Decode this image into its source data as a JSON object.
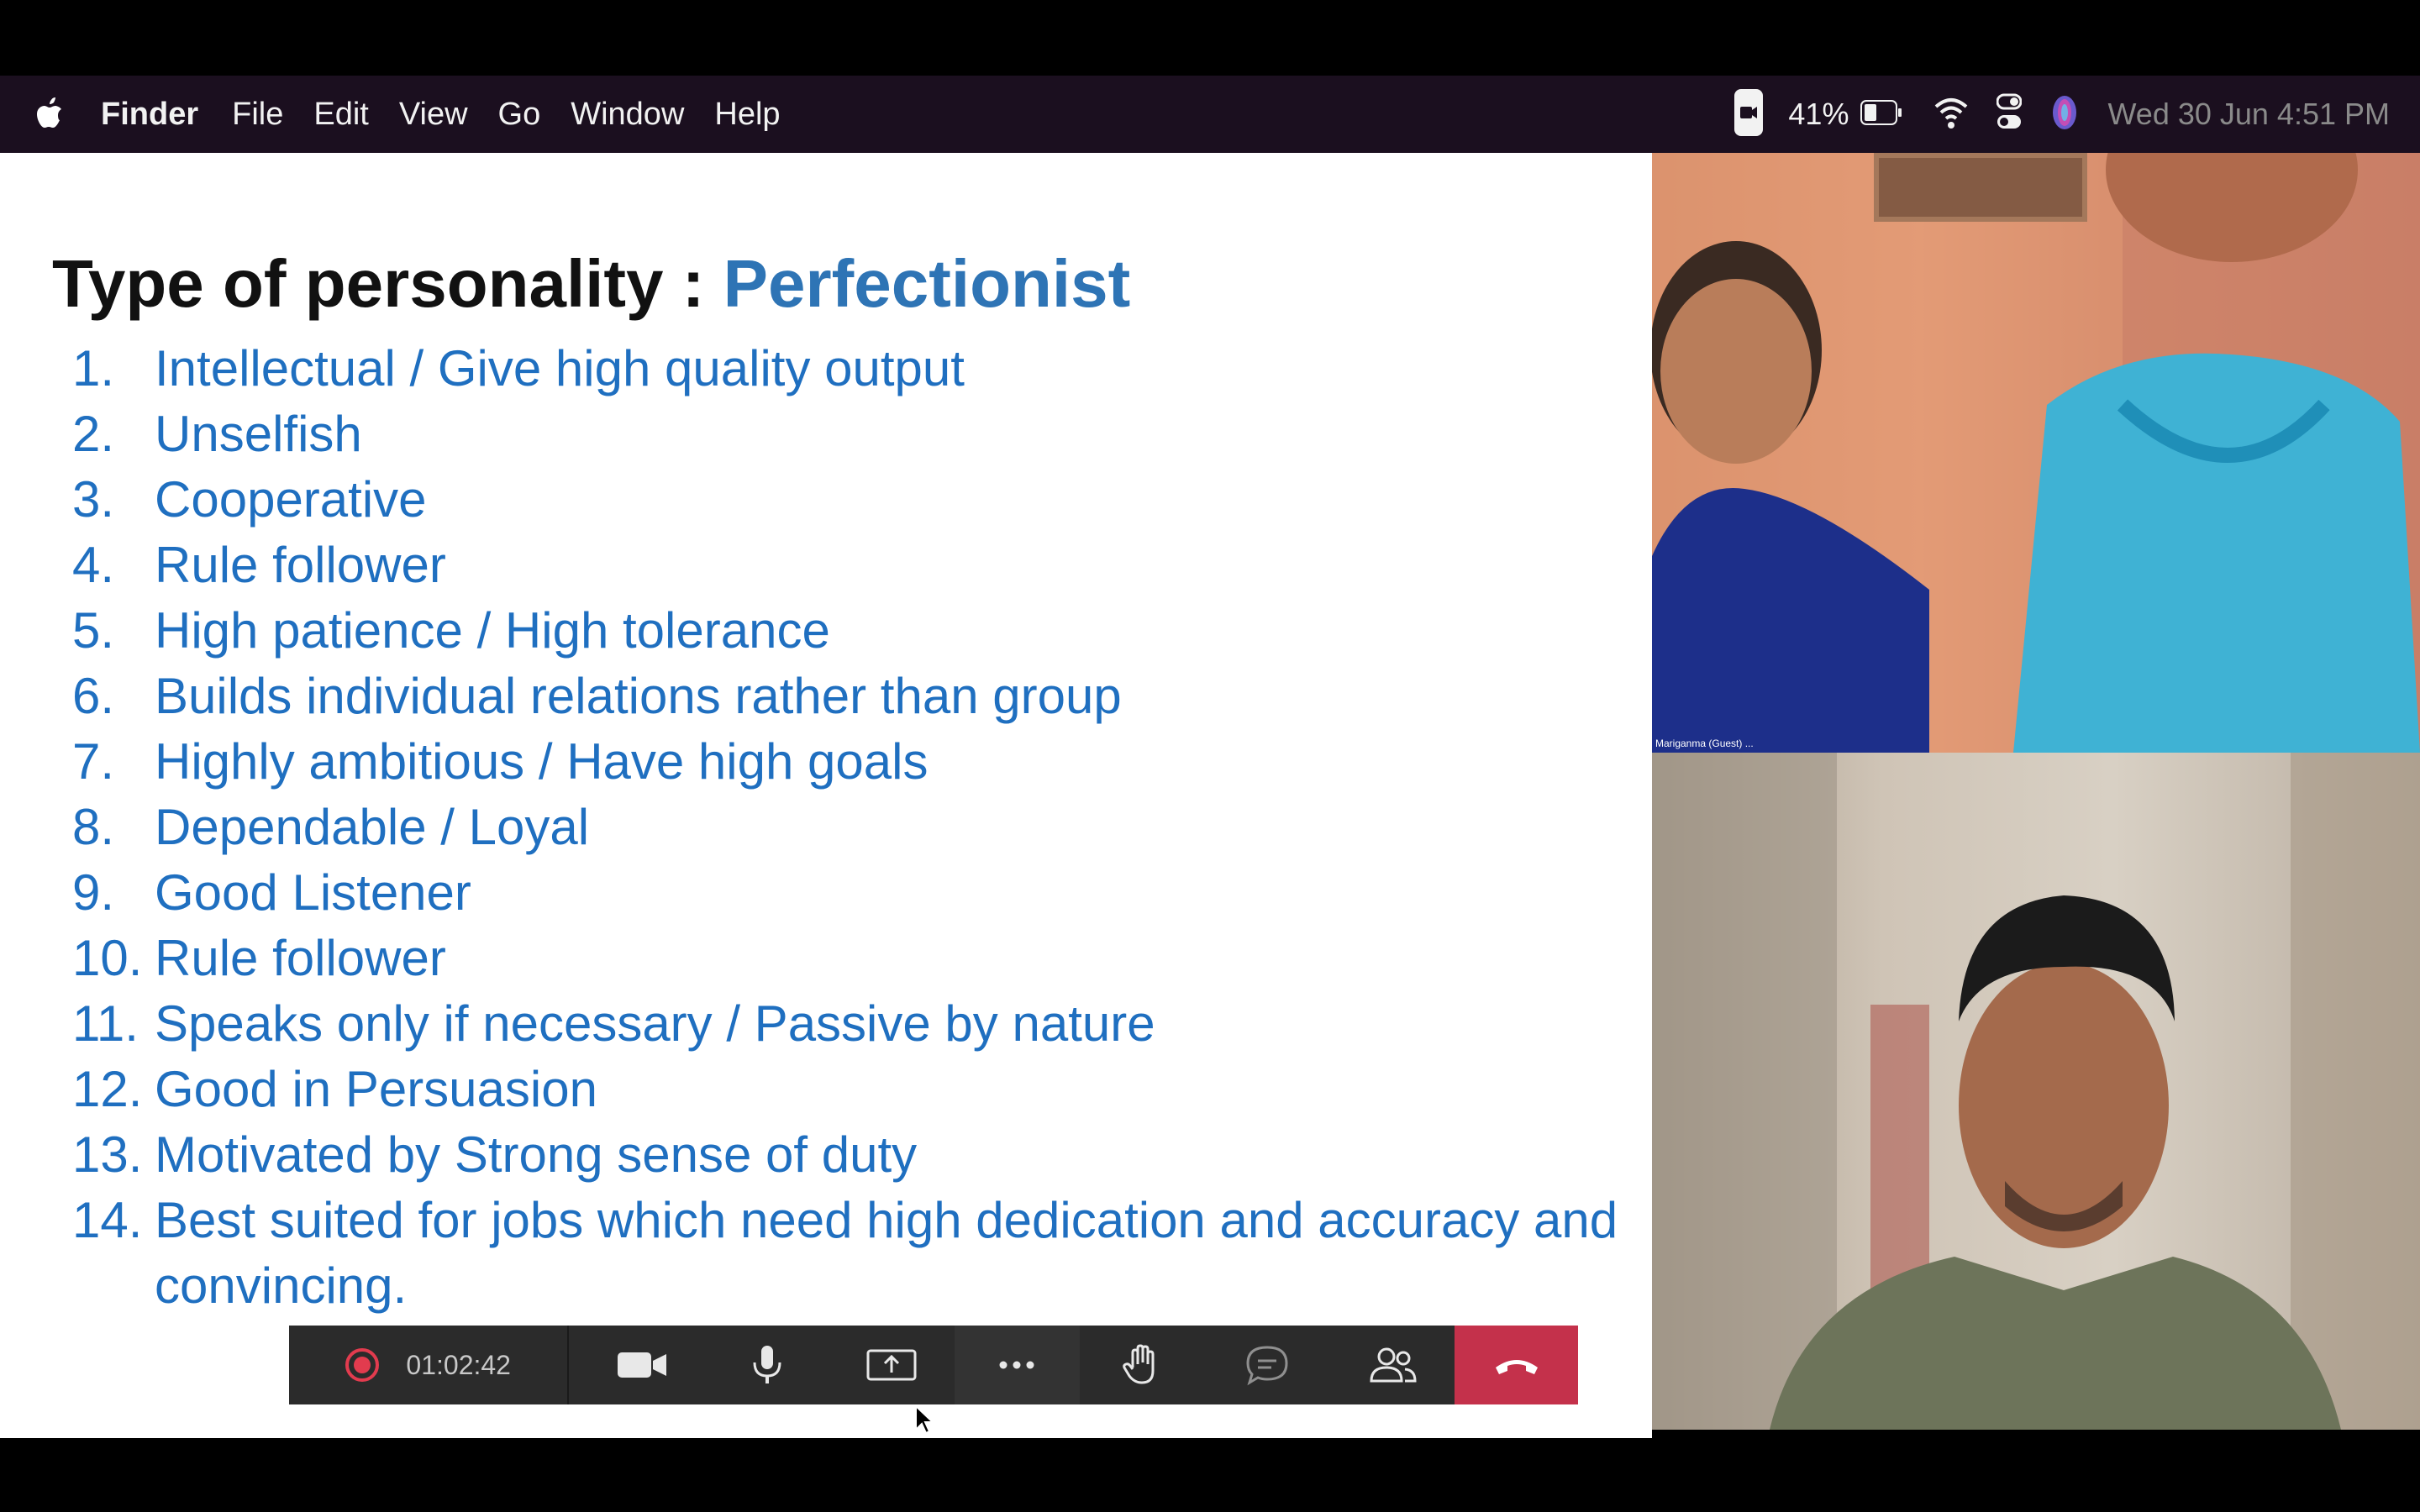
{
  "menubar": {
    "app_name": "Finder",
    "items": [
      "File",
      "Edit",
      "View",
      "Go",
      "Window",
      "Help"
    ],
    "battery_percent": "41%",
    "datetime": "Wed 30 Jun  4:51 PM"
  },
  "slide": {
    "title_prefix": "Type of personality : ",
    "title_accent": "Perfectionist",
    "items": [
      {
        "num": "1.",
        "text": "Intellectual  /  Give high quality output"
      },
      {
        "num": "2.",
        "text": "Unselfish"
      },
      {
        "num": "3.",
        "text": "Cooperative"
      },
      {
        "num": "4.",
        "text": "Rule follower"
      },
      {
        "num": "5.",
        "text": "High patience / High tolerance"
      },
      {
        "num": "6.",
        "text": "Builds individual relations rather than group"
      },
      {
        "num": "7.",
        "text": "Highly ambitious / Have high goals"
      },
      {
        "num": "8.",
        "text": "Dependable / Loyal"
      },
      {
        "num": "9.",
        "text": "Good Listener"
      },
      {
        "num": "10.",
        "text": "Rule follower"
      },
      {
        "num": "11.",
        "text": "Speaks only if necessary / Passive by nature"
      },
      {
        "num": "12.",
        "text": "Good in Persuasion"
      },
      {
        "num": "13.",
        "text": "Motivated by  Strong sense of duty"
      },
      {
        "num": "14.",
        "text": "Best suited for jobs which need high dedication and accuracy and convincing."
      }
    ]
  },
  "controls": {
    "timer": "01:02:42"
  },
  "video": {
    "tile1_label": "Mariganma (Guest) ..."
  },
  "colors": {
    "accent_blue": "#2e74b5",
    "list_blue": "#1f6fc0",
    "hangup_red": "#c4314b",
    "record_red": "#e23b4e"
  }
}
